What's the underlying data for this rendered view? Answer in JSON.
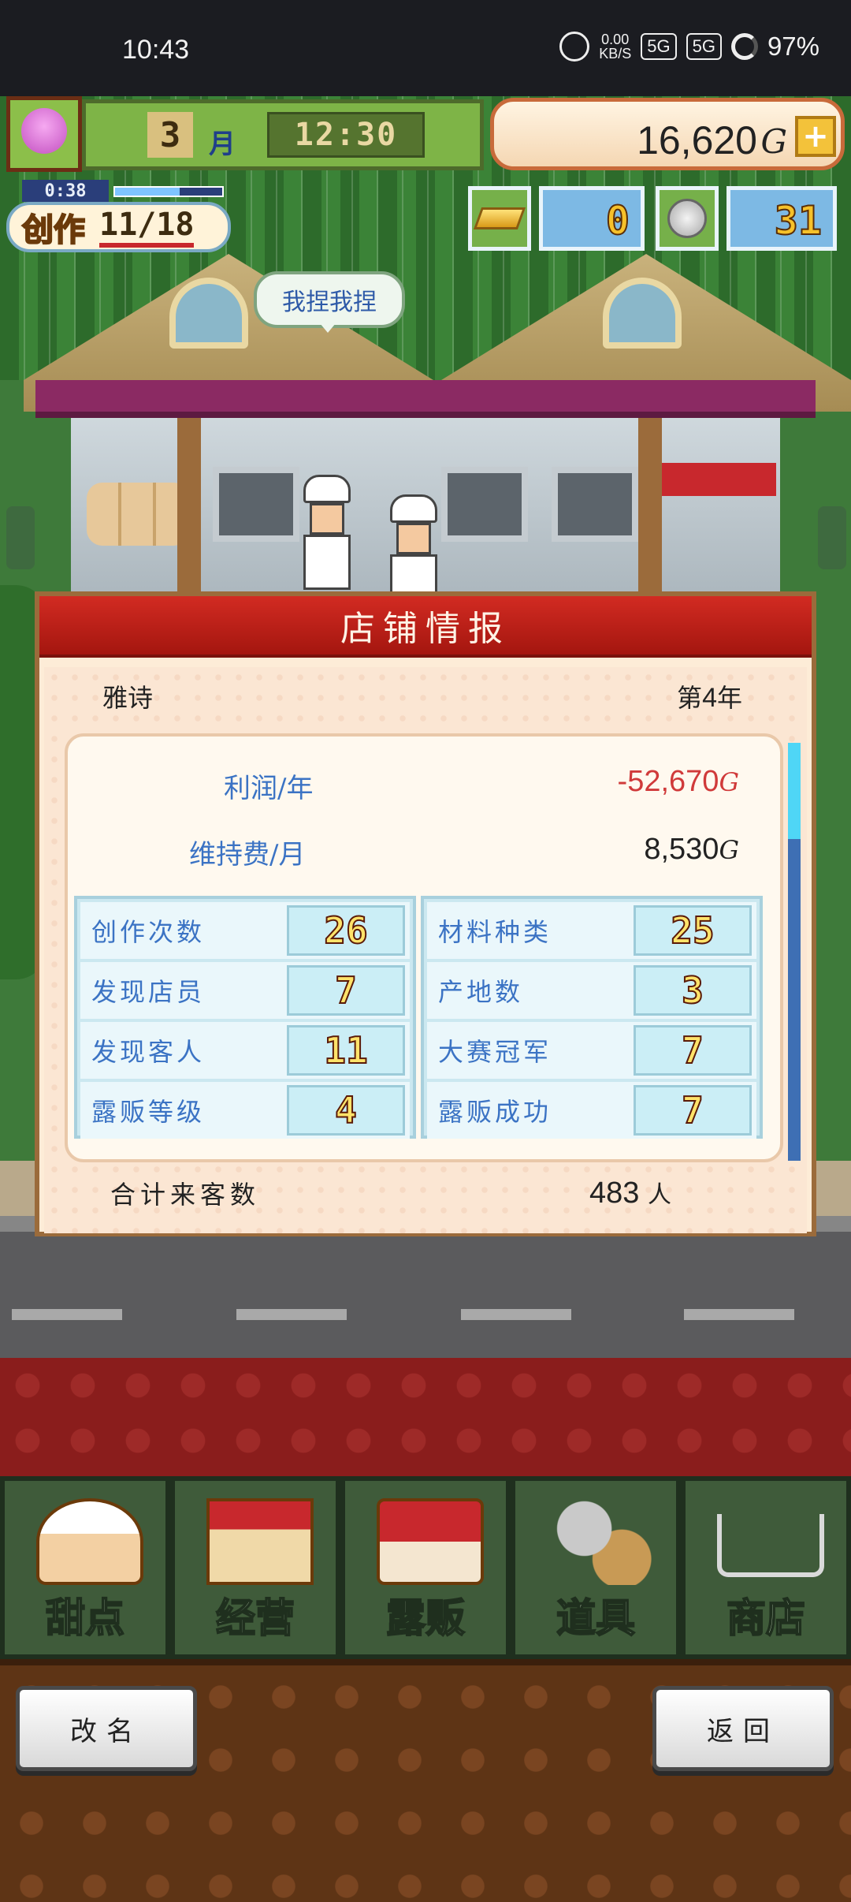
{
  "status_bar": {
    "time": "10:43",
    "net_speed": "0.00",
    "net_unit": "KB/S",
    "signal1": "5G",
    "signal2": "5G",
    "battery": "97%"
  },
  "hud": {
    "month_num": "3",
    "month_label": "月",
    "clock": "12:30",
    "money": "16,620",
    "money_unit": "G",
    "plus": "+",
    "create_timer": "0:38",
    "create_label": "创作",
    "create_count": "11/18",
    "create_progress": 0.6,
    "gold_count": "0",
    "coin_count": "31",
    "speech": "我捏我捏"
  },
  "dialog": {
    "title": "店铺情报",
    "shop_name": "雅诗",
    "year_prefix": "第",
    "year_num": "4",
    "year_suffix": "年",
    "profit_label": "利润/年",
    "profit_value": "-52,670",
    "upkeep_label": "维持费/月",
    "upkeep_value": "8,530",
    "unit": "G",
    "stats_left": [
      {
        "label": "创作次数",
        "value": "26"
      },
      {
        "label": "发现店员",
        "value": "7"
      },
      {
        "label": "发现客人",
        "value": "11"
      },
      {
        "label": "露贩等级",
        "value": "4"
      }
    ],
    "stats_right": [
      {
        "label": "材料种类",
        "value": "25"
      },
      {
        "label": "产地数",
        "value": "3"
      },
      {
        "label": "大赛冠军",
        "value": "7"
      },
      {
        "label": "露贩成功",
        "value": "7"
      }
    ],
    "total_label": "合计来客数",
    "total_value": "483",
    "total_unit": "人",
    "scroll_position": 0.0
  },
  "menu": {
    "items": [
      {
        "label": "甜点",
        "icon": "cake-icon"
      },
      {
        "label": "经营",
        "icon": "shop-icon"
      },
      {
        "label": "露贩",
        "icon": "food-truck-icon"
      },
      {
        "label": "道具",
        "icon": "items-icon"
      },
      {
        "label": "商店",
        "icon": "shopping-cart-icon"
      }
    ]
  },
  "footer": {
    "rename": "改名",
    "back": "返回"
  }
}
